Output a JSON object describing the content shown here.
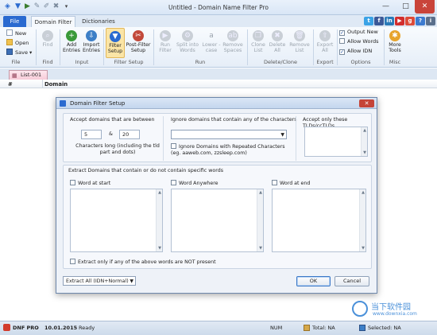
{
  "window": {
    "title": "Untitled - Domain Name Filter Pro",
    "controls": {
      "minimize": "—",
      "maximize": "□",
      "close": "✕"
    }
  },
  "menu": {
    "file": "File",
    "tabs": [
      "Domain Filter",
      "Dictionaries"
    ]
  },
  "social": [
    "t",
    "f",
    "in",
    "▶",
    "g",
    "?",
    "i"
  ],
  "ribbon": {
    "file_group": {
      "items": [
        "New",
        "Open",
        "Save"
      ],
      "label": "File"
    },
    "find_group": {
      "button": "Find",
      "label": "Find"
    },
    "input_group": {
      "buttons": [
        "Add Entries",
        "Import Entries"
      ],
      "label": "Input"
    },
    "filter_group": {
      "buttons": [
        "Filter Setup",
        "Post-Filter Setup"
      ],
      "label": "Filter Setup"
    },
    "run_group": {
      "buttons": [
        "Run Filter",
        "Split into Words",
        "Lower -case",
        "Remove Spaces"
      ],
      "label": "Run"
    },
    "delete_group": {
      "buttons": [
        "Clone List",
        "Delete All",
        "Remove List"
      ],
      "label": "Delete/Clone"
    },
    "export_group": {
      "button": "Export All",
      "label": "Export"
    },
    "options_group": {
      "items": [
        "Output New",
        "Allow Words",
        "Allow IDN"
      ],
      "checked": [
        true,
        false,
        true
      ],
      "label": "Options"
    },
    "misc_group": {
      "button": "More Tools",
      "label": "Misc"
    }
  },
  "doc_tab": "List-001",
  "grid": {
    "columns": [
      "#",
      "Domain"
    ]
  },
  "dialog": {
    "title": "Domain Filter Setup",
    "accept_between": {
      "heading": "Accept domains that are between",
      "min": "5",
      "amp": "&",
      "max": "20",
      "note": "Characters long (including the tld part and dots)"
    },
    "ignore": {
      "heading": "Ignore domains that contain any of the characters",
      "repeated_label": "Ignore Domains with Repeated Characters (eg. aaweb.com, zzsleep.com)"
    },
    "tlds": {
      "heading": "Accept only these TLDs/ccTLDs"
    },
    "extract": {
      "heading": "Extract Domains that contain or do not contain specific words",
      "options": [
        "Word at start",
        "Word Anywhere",
        "Word at end"
      ],
      "not_present": "Extract only if any of the above words are NOT present"
    },
    "mode_select": "Extract All (IDN+Normal)",
    "ok": "OK",
    "cancel": "Cancel"
  },
  "status": {
    "product": "DNF PRO",
    "date": "10.01.2015",
    "state": "Ready",
    "num": "NUM",
    "total": "Total: NA",
    "selected": "Selected: NA"
  },
  "watermark": {
    "text": "当下软件园",
    "url": "www.downxia.com"
  },
  "colors": {
    "accent": "#2a6ad0",
    "dialog_close": "#c54438"
  }
}
